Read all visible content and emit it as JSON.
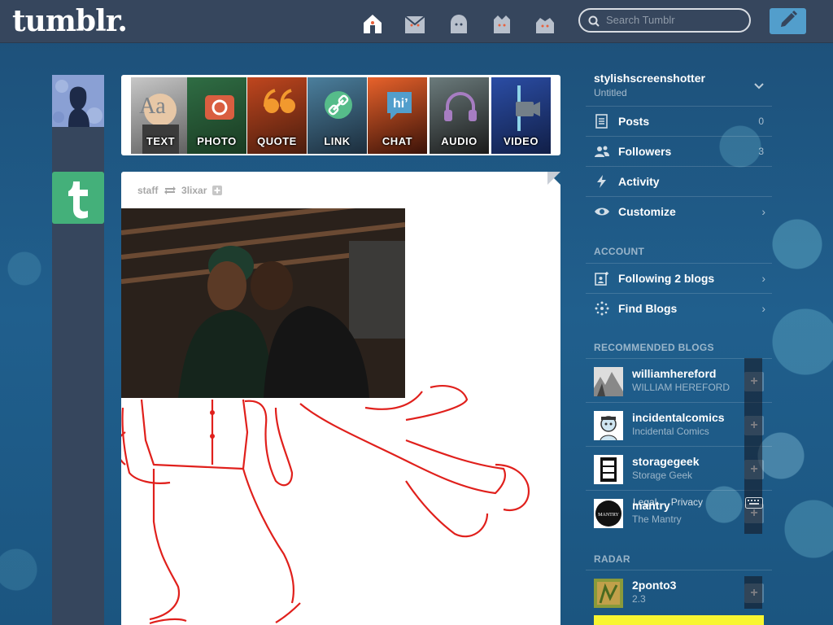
{
  "header": {
    "logo": "tumblr.",
    "search_placeholder": "Search Tumblr",
    "nav_icons": [
      "home-icon",
      "inbox-icon",
      "explore-icon",
      "activity-icon",
      "account-icon"
    ],
    "compose_icon": "pencil-icon"
  },
  "post_types": [
    {
      "label": "TEXT",
      "icon": "text-aa-icon",
      "color": "#9aa1a8"
    },
    {
      "label": "PHOTO",
      "icon": "camera-icon",
      "color": "#d95e40"
    },
    {
      "label": "QUOTE",
      "icon": "quote-icon",
      "color": "#f2992e"
    },
    {
      "label": "LINK",
      "icon": "link-icon",
      "color": "#56bc8a"
    },
    {
      "label": "CHAT",
      "icon": "chat-bubble-icon",
      "color": "#529ecc"
    },
    {
      "label": "AUDIO",
      "icon": "headphones-icon",
      "color": "#a77dc2"
    },
    {
      "label": "VIDEO",
      "icon": "video-camera-icon",
      "color": "#748089"
    }
  ],
  "post": {
    "author": "staff",
    "reblog_icon": "reblog-icon",
    "reblogged_from": "3lixar",
    "follow_icon": "plus-icon"
  },
  "sidebar": {
    "blog_name": "stylishscreenshotter",
    "blog_title": "Untitled",
    "menu": [
      {
        "label": "Posts",
        "count": "0",
        "icon": "posts-icon"
      },
      {
        "label": "Followers",
        "count": "3",
        "icon": "followers-icon"
      },
      {
        "label": "Activity",
        "count": "",
        "icon": "lightning-icon"
      },
      {
        "label": "Customize",
        "count": "",
        "icon": "eye-icon",
        "chevron": "›"
      }
    ],
    "account_heading": "ACCOUNT",
    "account_menu": [
      {
        "label": "Following 2 blogs",
        "icon": "following-icon",
        "chevron": "›"
      },
      {
        "label": "Find Blogs",
        "icon": "find-blogs-icon",
        "chevron": "›"
      }
    ],
    "recommended_heading": "RECOMMENDED BLOGS",
    "recommended": [
      {
        "name": "williamhereford",
        "title": "WILLIAM HEREFORD",
        "follow": "+"
      },
      {
        "name": "incidentalcomics",
        "title": "Incidental Comics",
        "follow": "+"
      },
      {
        "name": "storagegeek",
        "title": "Storage Geek",
        "follow": "+"
      },
      {
        "name": "mantry",
        "title": "The Mantry",
        "follow": "+"
      }
    ],
    "footer_links": [
      "Legal",
      "Privacy"
    ],
    "keyboard_icon": "keyboard-icon",
    "radar_heading": "RADAR",
    "radar": {
      "name": "2ponto3",
      "title": "2.3",
      "follow": "+"
    },
    "mantry_thumb_text": "MANTRY"
  }
}
